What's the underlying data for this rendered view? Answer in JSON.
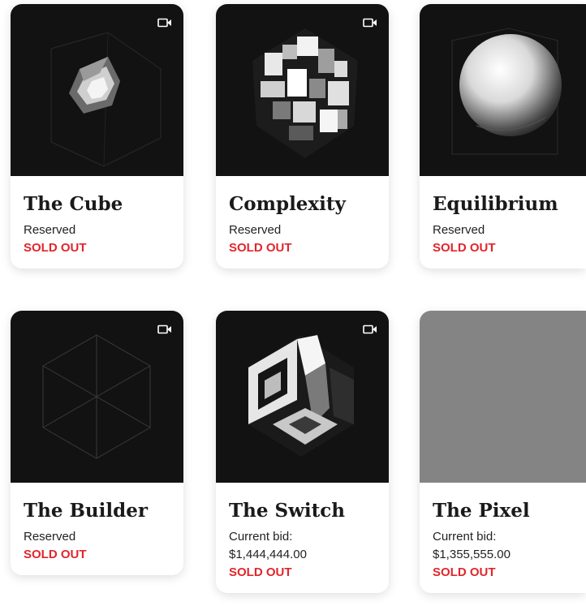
{
  "cards": [
    {
      "title": "The Cube",
      "status": "Reserved",
      "sold": "SOLD OUT",
      "icon": "video-camera-icon"
    },
    {
      "title": "Complexity",
      "status": "Reserved",
      "sold": "SOLD OUT",
      "icon": "video-camera-icon"
    },
    {
      "title": "Equilibrium",
      "status": "Reserved",
      "sold": "SOLD OUT"
    },
    {
      "title": "The Builder",
      "status": "Reserved",
      "sold": "SOLD OUT",
      "icon": "video-camera-icon"
    },
    {
      "title": "The Switch",
      "bid_label": "Current bid:",
      "bid_amount": "$1,444,444.00",
      "sold": "SOLD OUT",
      "icon": "video-camera-icon"
    },
    {
      "title": "The Pixel",
      "bid_label": "Current bid:",
      "bid_amount": "$1,355,555.00",
      "sold": "SOLD OUT"
    }
  ],
  "colors": {
    "sold_out": "#e0262b",
    "art_background": "#121212",
    "placeholder": "#848484"
  }
}
